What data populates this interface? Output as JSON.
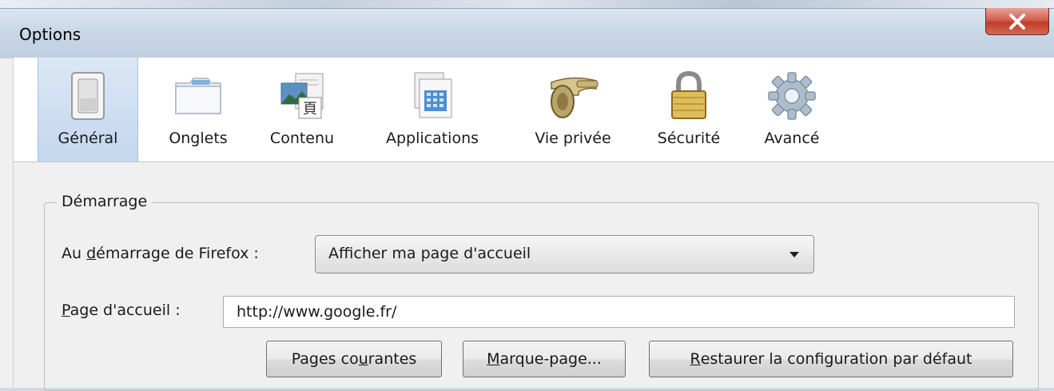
{
  "window": {
    "title": "Options",
    "close_glyph": "X"
  },
  "tabs": [
    {
      "label": "Général",
      "icon": "switch-icon",
      "active": true
    },
    {
      "label": "Onglets",
      "icon": "folder-tabs-icon",
      "active": false
    },
    {
      "label": "Contenu",
      "icon": "content-icon",
      "active": false
    },
    {
      "label": "Applications",
      "icon": "applications-icon",
      "active": false
    },
    {
      "label": "Vie privée",
      "icon": "privacy-mask-icon",
      "active": false
    },
    {
      "label": "Sécurité",
      "icon": "padlock-icon",
      "active": false
    },
    {
      "label": "Avancé",
      "icon": "gear-icon",
      "active": false
    }
  ],
  "startup": {
    "group_title": "Démarrage",
    "on_start_label_pre": "Au ",
    "on_start_label_ul": "d",
    "on_start_label_post": "émarrage de Firefox :",
    "on_start_value": "Afficher ma page d'accueil",
    "home_label_ul": "P",
    "home_label_post": "age d'accueil :",
    "home_value": "http://www.google.fr/",
    "btn_current_pre": "Pages co",
    "btn_current_ul": "u",
    "btn_current_post": "rantes",
    "btn_bookmark_ul": "M",
    "btn_bookmark_post": "arque-page...",
    "btn_restore_ul": "R",
    "btn_restore_post": "estaurer la configuration par défaut"
  },
  "colors": {
    "active_tab": "#c4d7ee",
    "close_button": "#c13c2a",
    "titlebar": "#c9d7e6"
  }
}
